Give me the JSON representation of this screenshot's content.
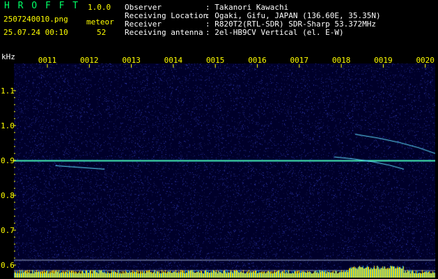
{
  "header": {
    "brand": "H R O F F T",
    "version": "1.0.0",
    "file_name": "2507240010.png",
    "timestamp": "25.07.24 00:10",
    "meteor_label": "meteor",
    "meteor_count": "52",
    "info_labels": [
      "Observer",
      "Receiving Location",
      "Receiver",
      "Receiving antenna"
    ],
    "info_values": [
      ": Takanori Kawachi",
      ": Ogaki, Gifu, JAPAN (136.60E, 35.35N)",
      ": R820T2(RTL-SDR) SDR-Sharp 53.372MHz",
      ": 2el-HB9CV Vertical (el. E-W)"
    ]
  },
  "chart_data": {
    "type": "heatmap",
    "y_unit": "kHz",
    "y_ticks": [
      "1.1",
      "1.0",
      "0.9",
      "0.8",
      "0.7",
      "0.6"
    ],
    "x_ticks": [
      "0011",
      "0012",
      "0013",
      "0014",
      "0015",
      "0016",
      "0017",
      "0018",
      "0019",
      "0020"
    ],
    "ylim": [
      0.6,
      1.2
    ],
    "carrier_khz": 0.9
  },
  "colors": {
    "background": "#00002a",
    "carrier": "#4cff9a",
    "tick": "#ffff00",
    "text": "#ffffff"
  }
}
